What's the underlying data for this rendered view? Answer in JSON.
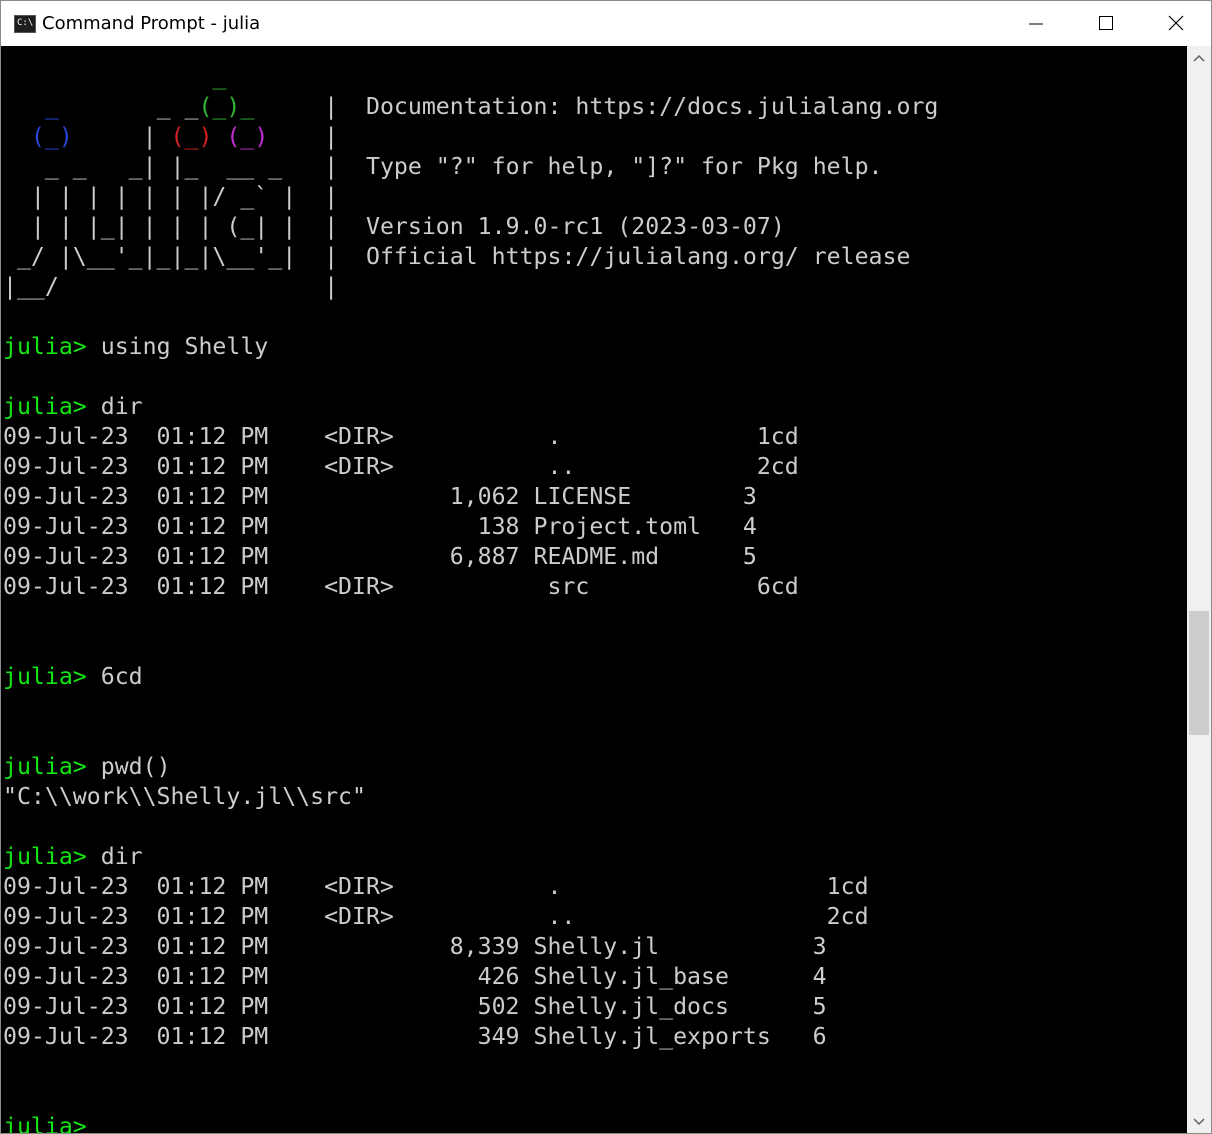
{
  "window": {
    "title": "Command Prompt - julia",
    "icon_text": "C:\\",
    "icon": "console-icon",
    "controls": [
      "minimize-icon",
      "maximize-icon",
      "close-icon"
    ]
  },
  "banner": {
    "logo": [
      "               _",
      "   _       _ _(_)_     |",
      "  (_)     | (_) (_)    |",
      "   _ _   _| |_  __ _   |",
      "  | | | | | | |/ _` |  |",
      "  | | |_| | | | (_| |  |",
      " _/ |\\__'_|_|_|\\__'_|  |",
      "|__/                   |"
    ],
    "info": [
      "Documentation: https://docs.julialang.org",
      "",
      "Type \"?\" for help, \"]?\" for Pkg help.",
      "",
      "Version 1.9.0-rc1 (2023-03-07)",
      "Official https://julialang.org/ release"
    ]
  },
  "session": [
    {
      "prompt": "julia> ",
      "text": "using Shelly"
    },
    {
      "prompt": "",
      "text": ""
    },
    {
      "prompt": "julia> ",
      "text": "dir"
    },
    {
      "prompt": "",
      "text": "09-Jul-23  01:12 PM    <DIR>           .              1cd"
    },
    {
      "prompt": "",
      "text": "09-Jul-23  01:12 PM    <DIR>           ..             2cd"
    },
    {
      "prompt": "",
      "text": "09-Jul-23  01:12 PM             1,062 LICENSE        3"
    },
    {
      "prompt": "",
      "text": "09-Jul-23  01:12 PM               138 Project.toml   4"
    },
    {
      "prompt": "",
      "text": "09-Jul-23  01:12 PM             6,887 README.md      5"
    },
    {
      "prompt": "",
      "text": "09-Jul-23  01:12 PM    <DIR>           src            6cd"
    },
    {
      "prompt": "",
      "text": ""
    },
    {
      "prompt": "",
      "text": ""
    },
    {
      "prompt": "julia> ",
      "text": "6cd"
    },
    {
      "prompt": "",
      "text": ""
    },
    {
      "prompt": "",
      "text": ""
    },
    {
      "prompt": "julia> ",
      "text": "pwd()"
    },
    {
      "prompt": "",
      "text": "\"C:\\\\work\\\\Shelly.jl\\\\src\""
    },
    {
      "prompt": "",
      "text": ""
    },
    {
      "prompt": "julia> ",
      "text": "dir"
    },
    {
      "prompt": "",
      "text": "09-Jul-23  01:12 PM    <DIR>           .                   1cd"
    },
    {
      "prompt": "",
      "text": "09-Jul-23  01:12 PM    <DIR>           ..                  2cd"
    },
    {
      "prompt": "",
      "text": "09-Jul-23  01:12 PM             8,339 Shelly.jl           3"
    },
    {
      "prompt": "",
      "text": "09-Jul-23  01:12 PM               426 Shelly.jl_base      4"
    },
    {
      "prompt": "",
      "text": "09-Jul-23  01:12 PM               502 Shelly.jl_docs      5"
    },
    {
      "prompt": "",
      "text": "09-Jul-23  01:12 PM               349 Shelly.jl_exports   6"
    },
    {
      "prompt": "",
      "text": ""
    },
    {
      "prompt": "",
      "text": ""
    },
    {
      "prompt": "julia>",
      "text": ""
    }
  ],
  "colors": {
    "background": "#000000",
    "text": "#cccccc",
    "prompt": "#13e713",
    "julia_green": "#35b535",
    "julia_blue": "#2a46d8",
    "julia_red": "#d22222",
    "julia_purple": "#c32ed2"
  },
  "scrollbar": {
    "up": "scroll-up-arrow-icon",
    "down": "scroll-down-arrow-icon"
  }
}
